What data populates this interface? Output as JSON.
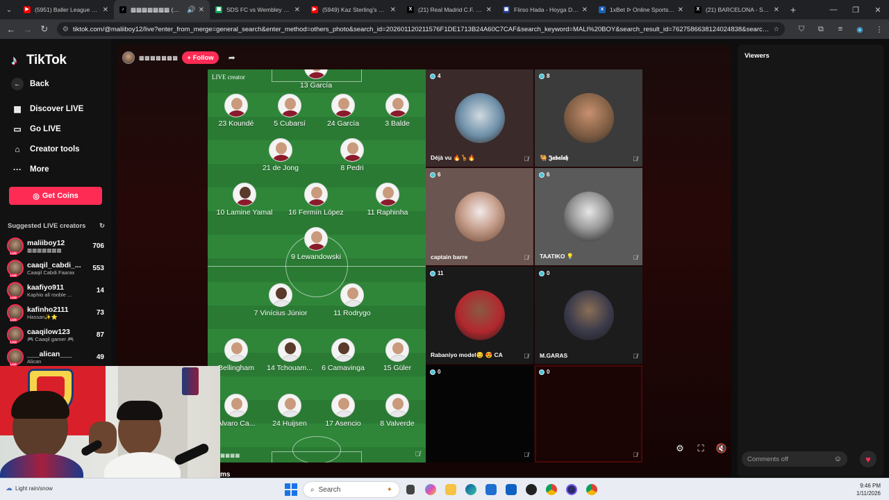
{
  "browser": {
    "tabs": [
      {
        "title": "(5951) Baller League Fina",
        "color": "#ff0000",
        "glyph": "▶",
        "active": false
      },
      {
        "title": "▩▩▩▩▩▩▩ (@mali",
        "color": "#000000",
        "glyph": "♪",
        "active": true
      },
      {
        "title": "SDS FC vs Wembley Rang",
        "color": "#0f9d58",
        "glyph": "▦",
        "active": false
      },
      {
        "title": "(5949) Kaz Sterling's SEN",
        "color": "#ff0000",
        "glyph": "▶",
        "active": false
      },
      {
        "title": "(21) Real Madrid C.F. (@re",
        "color": "#000000",
        "glyph": "X",
        "active": false
      },
      {
        "title": "Fiirso Hada - Hoyga Daav",
        "color": "#1f3b8c",
        "glyph": "▣",
        "active": false
      },
      {
        "title": "1xBet ᐅ Online Sports Be",
        "color": "#1a5fb4",
        "glyph": "x",
        "active": false
      },
      {
        "title": "(21) BARCELONA - Search",
        "color": "#000000",
        "glyph": "X",
        "active": false
      }
    ],
    "url": "tiktok.com/@maliiboy12/live?enter_from_merge=general_search&enter_method=others_photo&search_id=202601120211576F1DE1713B24A60C7CAF&search_keyword=MALI%20BOY&search_result_id=7627586638124024838&search_type=g..."
  },
  "sidebar": {
    "brand": "TikTok",
    "back": "Back",
    "nav": [
      {
        "label": "Discover LIVE",
        "icon": "calendar-icon"
      },
      {
        "label": "Go LIVE",
        "icon": "camera-icon"
      },
      {
        "label": "Creator tools",
        "icon": "home-icon"
      },
      {
        "label": "More",
        "icon": "ellipsis-icon"
      }
    ],
    "coins_label": "Get Coins",
    "suggested_title": "Suggested LIVE creators",
    "creators": [
      {
        "name": "maliiboy12",
        "sub": "▩▩▩▩▩▩▩",
        "count": "706"
      },
      {
        "name": "caaqil_cabdi_...",
        "sub": "Caaqil Cabdi Faarax",
        "count": "553"
      },
      {
        "name": "kaafiyo911",
        "sub": "Kaphio all rooble ...",
        "count": "14"
      },
      {
        "name": "kafinho2111",
        "sub": "Hassan✨⭐",
        "count": "73"
      },
      {
        "name": "caaqilow123",
        "sub": "🎮 Caaqil gamer 🎮",
        "count": "87"
      },
      {
        "name": "___alican___",
        "sub": "Alican",
        "count": "49"
      }
    ]
  },
  "stream": {
    "host_name": "▩▩▩▩▩▩▩",
    "follow_label": "+ Follow",
    "live_creator_label": "LIVE creator",
    "pitch_footer": "▩▩▩▩▩▩",
    "players": [
      {
        "label": "13 García",
        "team": "barca"
      },
      {
        "label": "23 Koundé",
        "team": "barca"
      },
      {
        "label": "5 Cubarsí",
        "team": "barca"
      },
      {
        "label": "24 García",
        "team": "barca"
      },
      {
        "label": "3 Balde",
        "team": "barca"
      },
      {
        "label": "21 de Jong",
        "team": "barca"
      },
      {
        "label": "8 Pedri",
        "team": "barca"
      },
      {
        "label": "10 Lamine Yamal",
        "team": "barca"
      },
      {
        "label": "16 Fermín López",
        "team": "barca"
      },
      {
        "label": "11 Raphinha",
        "team": "barca"
      },
      {
        "label": "9 Lewandowski",
        "team": "barca"
      },
      {
        "label": "7 Vinícius Júnior",
        "team": "madrid"
      },
      {
        "label": "11 Rodrygo",
        "team": "madrid"
      },
      {
        "label": "Bellingham",
        "team": "madrid"
      },
      {
        "label": "14 Tchouam...",
        "team": "madrid"
      },
      {
        "label": "6 Camavinga",
        "team": "madrid"
      },
      {
        "label": "15 Güler",
        "team": "madrid"
      },
      {
        "label": "Alvaro Ca...",
        "team": "madrid"
      },
      {
        "label": "24 Huijsen",
        "team": "madrid"
      },
      {
        "label": "17 Asencio",
        "team": "madrid"
      },
      {
        "label": "8 Valverde",
        "team": "madrid"
      }
    ],
    "guests": [
      {
        "name": "Déjà vu 🔥🦒🔥",
        "count": "4",
        "bg": "#3a2a2a"
      },
      {
        "name": "🐫 𝕵𝖆𝖇𝖆𝖑𝖆𝖍",
        "count": "8",
        "bg": "#3b3b3b"
      },
      {
        "name": "captain barre",
        "count": "6",
        "bg": "#6a5550"
      },
      {
        "name": "TAATIKO 💡",
        "count": "6",
        "bg": "#5a5a5a"
      },
      {
        "name": "Rabaniyo model😏 😍 CA",
        "count": "11",
        "bg": "#1a1a1a"
      },
      {
        "name": "M.GARAS",
        "count": "0",
        "bg": "#1c1c1c"
      },
      {
        "name": "",
        "count": "0",
        "bg": "#050505"
      },
      {
        "name": "",
        "count": "0",
        "bg": "#1a0404"
      }
    ]
  },
  "viewers": {
    "title": "Viewers",
    "comments_placeholder": "Comments off"
  },
  "tail_text": "ms",
  "taskbar": {
    "weather": "Light rain/snow",
    "search_label": "Search",
    "time": "9:46 PM",
    "date": "1/11/2026"
  }
}
